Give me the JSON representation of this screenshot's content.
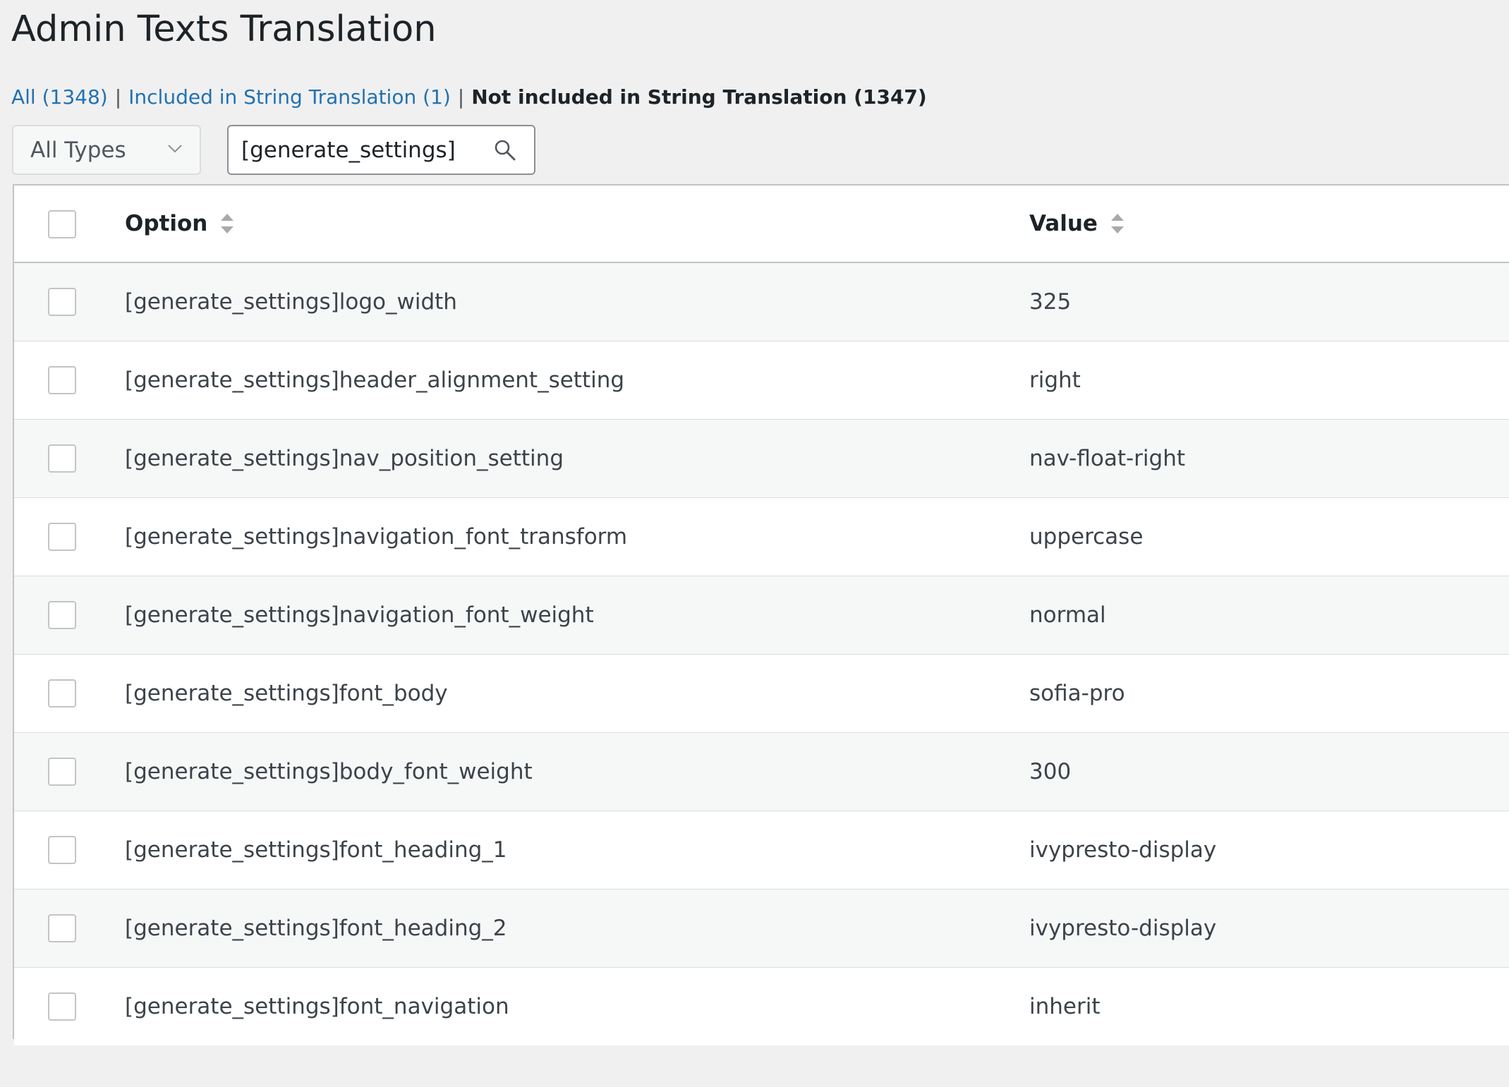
{
  "page": {
    "title": "Admin Texts Translation"
  },
  "filters": [
    {
      "label": "All (1348)",
      "current": false
    },
    {
      "label": "Included in String Translation (1)",
      "current": false
    },
    {
      "label": "Not included in String Translation (1347)",
      "current": true
    }
  ],
  "filter_separator": "|",
  "type_select": {
    "value": "All Types",
    "icon": "chevron-down-icon"
  },
  "search": {
    "value": "[generate_settings]",
    "icon": "search-icon"
  },
  "table": {
    "columns": {
      "option": "Option",
      "value": "Value"
    },
    "rows": [
      {
        "option": "[generate_settings]logo_width",
        "value": "325"
      },
      {
        "option": "[generate_settings]header_alignment_setting",
        "value": "right"
      },
      {
        "option": "[generate_settings]nav_position_setting",
        "value": "nav-float-right"
      },
      {
        "option": "[generate_settings]navigation_font_transform",
        "value": "uppercase"
      },
      {
        "option": "[generate_settings]navigation_font_weight",
        "value": "normal"
      },
      {
        "option": "[generate_settings]font_body",
        "value": "sofia-pro"
      },
      {
        "option": "[generate_settings]body_font_weight",
        "value": "300"
      },
      {
        "option": "[generate_settings]font_heading_1",
        "value": "ivypresto-display"
      },
      {
        "option": "[generate_settings]font_heading_2",
        "value": "ivypresto-display"
      },
      {
        "option": "[generate_settings]font_navigation",
        "value": "inherit"
      }
    ]
  },
  "colors": {
    "link": "#2271b1",
    "background": "#f0f0f1",
    "border": "#c3c4c7"
  }
}
